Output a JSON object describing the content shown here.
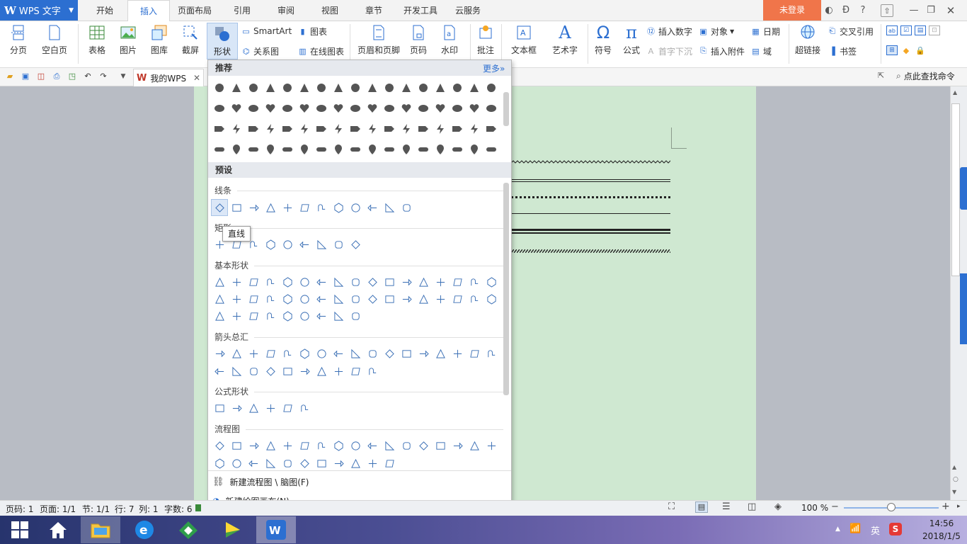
{
  "app": {
    "title": "WPS 文字",
    "login": "未登录"
  },
  "tabs": [
    "开始",
    "插入",
    "页面布局",
    "引用",
    "审阅",
    "视图",
    "章节",
    "开发工具",
    "云服务"
  ],
  "active_tab": "插入",
  "ribbon": {
    "page_break": "分页",
    "blank_page": "空白页",
    "table": "表格",
    "picture": "图片",
    "gallery": "图库",
    "screenshot": "截屏",
    "shapes": "形状",
    "smartart": "SmartArt",
    "chart": "图表",
    "relation": "关系图",
    "online_chart": "在线图表",
    "header_footer": "页眉和页脚",
    "page_number": "页码",
    "watermark": "水印",
    "comment": "批注",
    "textbox": "文本框",
    "wordart": "艺术字",
    "symbol": "符号",
    "formula": "公式",
    "insert_number": "插入数字",
    "drop_cap": "首字下沉",
    "object": "对象",
    "attachment": "插入附件",
    "date": "日期",
    "field": "域",
    "hyperlink": "超链接",
    "cross_ref": "交叉引用",
    "bookmark": "书签",
    "search": "点此查找命令"
  },
  "doc_tab": "我的WPS",
  "dropdown": {
    "recommended": "推荐",
    "more": "更多",
    "presets": "预设",
    "lines": "线条",
    "rect": "矩形",
    "basic": "基本形状",
    "arrows": "箭头总汇",
    "equation": "公式形状",
    "flowchart": "流程图",
    "tooltip": "直线",
    "new_flowchart": "新建流程图 \\ 脑图(F)",
    "new_canvas": "新建绘图画布(N)"
  },
  "status": {
    "page": "页码: 1",
    "pages": "页面: 1/1",
    "section": "节: 1/1",
    "row": "行: 7",
    "col": "列: 1",
    "words": "字数: 6",
    "zoom": "100 %"
  },
  "taskbar": {
    "lang": "英",
    "time": "14:56",
    "date": "2018/1/5"
  }
}
